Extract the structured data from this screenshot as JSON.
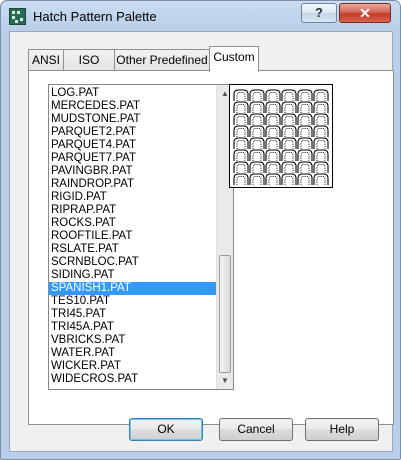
{
  "window": {
    "title": "Hatch Pattern Palette",
    "help_glyph": "?",
    "close_glyph": "✕"
  },
  "tabs": [
    {
      "label": "ANSI",
      "active": false
    },
    {
      "label": "ISO",
      "active": false
    },
    {
      "label": "Other Predefined",
      "active": false
    },
    {
      "label": "Custom",
      "active": true
    }
  ],
  "list": {
    "items": [
      "LOG.PAT",
      "MERCEDES.PAT",
      "MUDSTONE.PAT",
      "PARQUET2.PAT",
      "PARQUET4.PAT",
      "PARQUET7.PAT",
      "PAVINGBR.PAT",
      "RAINDROP.PAT",
      "RIGID.PAT",
      "RIPRAP.PAT",
      "ROCKS.PAT",
      "ROOFTILE.PAT",
      "RSLATE.PAT",
      "SCRNBLOC.PAT",
      "SIDING.PAT",
      "SPANISH1.PAT",
      "TES10.PAT",
      "TRI45.PAT",
      "TRI45A.PAT",
      "VBRICKS.PAT",
      "WATER.PAT",
      "WICKER.PAT",
      "WIDECROS.PAT"
    ],
    "selected": "SPANISH1.PAT",
    "scroll_up_glyph": "▲",
    "scroll_down_glyph": "▼"
  },
  "preview": {
    "pattern_name": "SPANISH1.PAT",
    "icon": "hatch-preview-spanish-tile"
  },
  "buttons": {
    "ok": "OK",
    "cancel": "Cancel",
    "help": "Help"
  },
  "colors": {
    "selection": "#3399ff",
    "close_button": "#c33b26",
    "titlebar": "#c9dcf1"
  }
}
